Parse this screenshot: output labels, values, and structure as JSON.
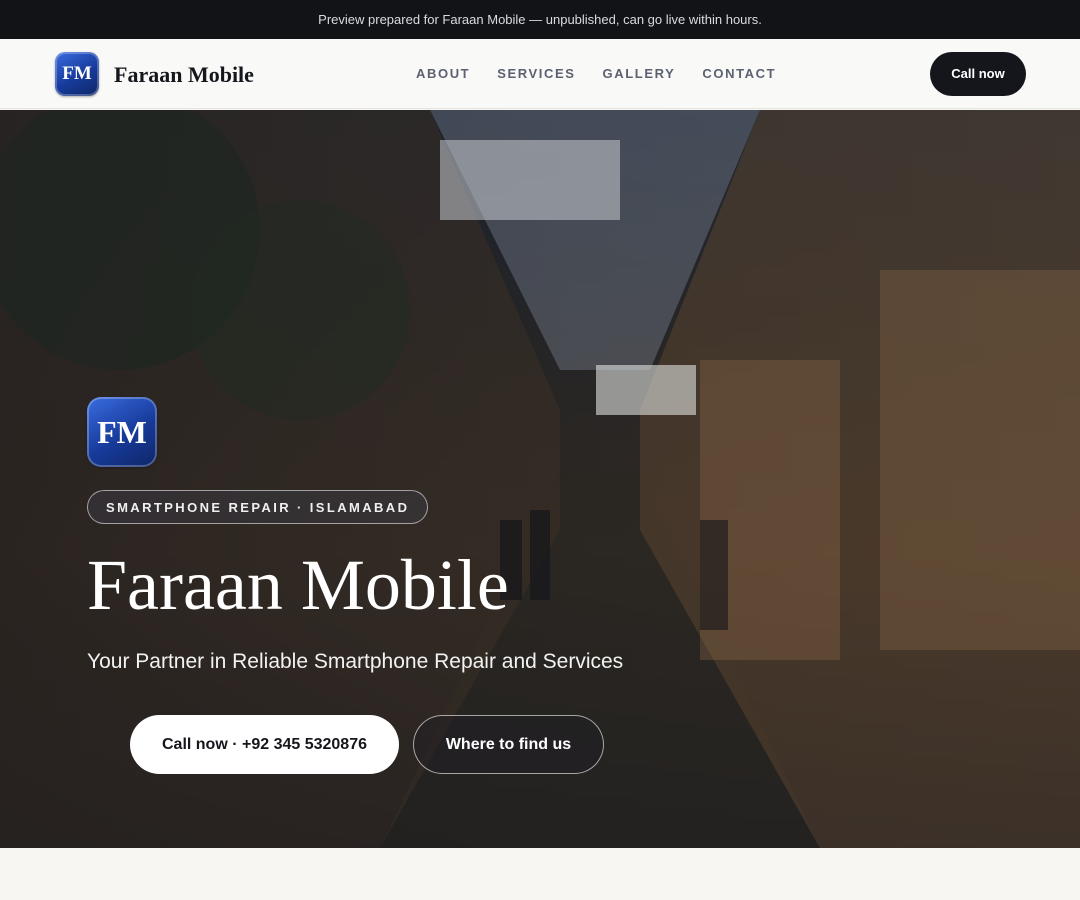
{
  "banner": {
    "text": "Preview prepared for Faraan Mobile — unpublished, can go live within hours."
  },
  "nav": {
    "logo_text": "FM",
    "brand": "Faraan Mobile",
    "links": [
      {
        "label": "ABOUT"
      },
      {
        "label": "SERVICES"
      },
      {
        "label": "GALLERY"
      },
      {
        "label": "CONTACT"
      }
    ],
    "cta": "Call now"
  },
  "hero": {
    "logo_text": "FM",
    "tagline": "SMARTPHONE REPAIR · ISLAMABAD",
    "title": "Faraan Mobile",
    "subtitle": "Your Partner in Reliable Smartphone Repair and Services",
    "primary_button": "Call now · +92 345 5320876",
    "secondary_button": "Where to find us"
  },
  "colors": {
    "accent": "#14161b",
    "logo_blue": "#1f4bbd",
    "banner_bg": "#111317",
    "page_bg": "#f7f6f3"
  }
}
